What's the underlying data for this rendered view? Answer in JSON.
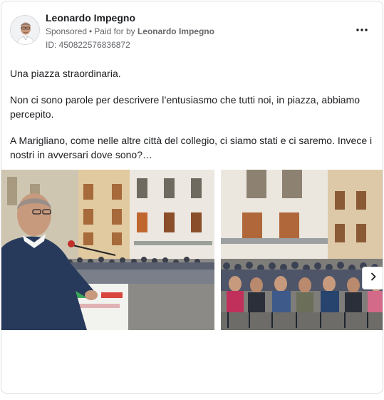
{
  "ad": {
    "advertiser": "Leonardo Impegno",
    "sponsored_label": "Sponsored",
    "separator": "•",
    "paid_for_prefix": "Paid for by",
    "paid_for_name": "Leonardo Impegno",
    "id_text": "ID: 450822576836872",
    "more_glyph": "•••"
  },
  "body": {
    "paragraphs": [
      "Una piazza straordinaria.",
      "Non ci sono parole per descrivere l’entusiasmo che tutti noi, in piazza, abbiamo percepito.",
      "A Marigliano, come nelle altre città del collegio, ci siamo stati e ci saremo. Invece i nostri in avversari dove sono?…"
    ]
  },
  "carousel": {
    "images": [
      {
        "subject": "speaker at podium in crowded town square"
      },
      {
        "subject": "seated audience in town square"
      }
    ],
    "next_icon": "chevron-right-icon"
  },
  "colors": {
    "text_primary": "#1c1e21",
    "text_secondary": "#65676b",
    "border": "#dadde1"
  }
}
